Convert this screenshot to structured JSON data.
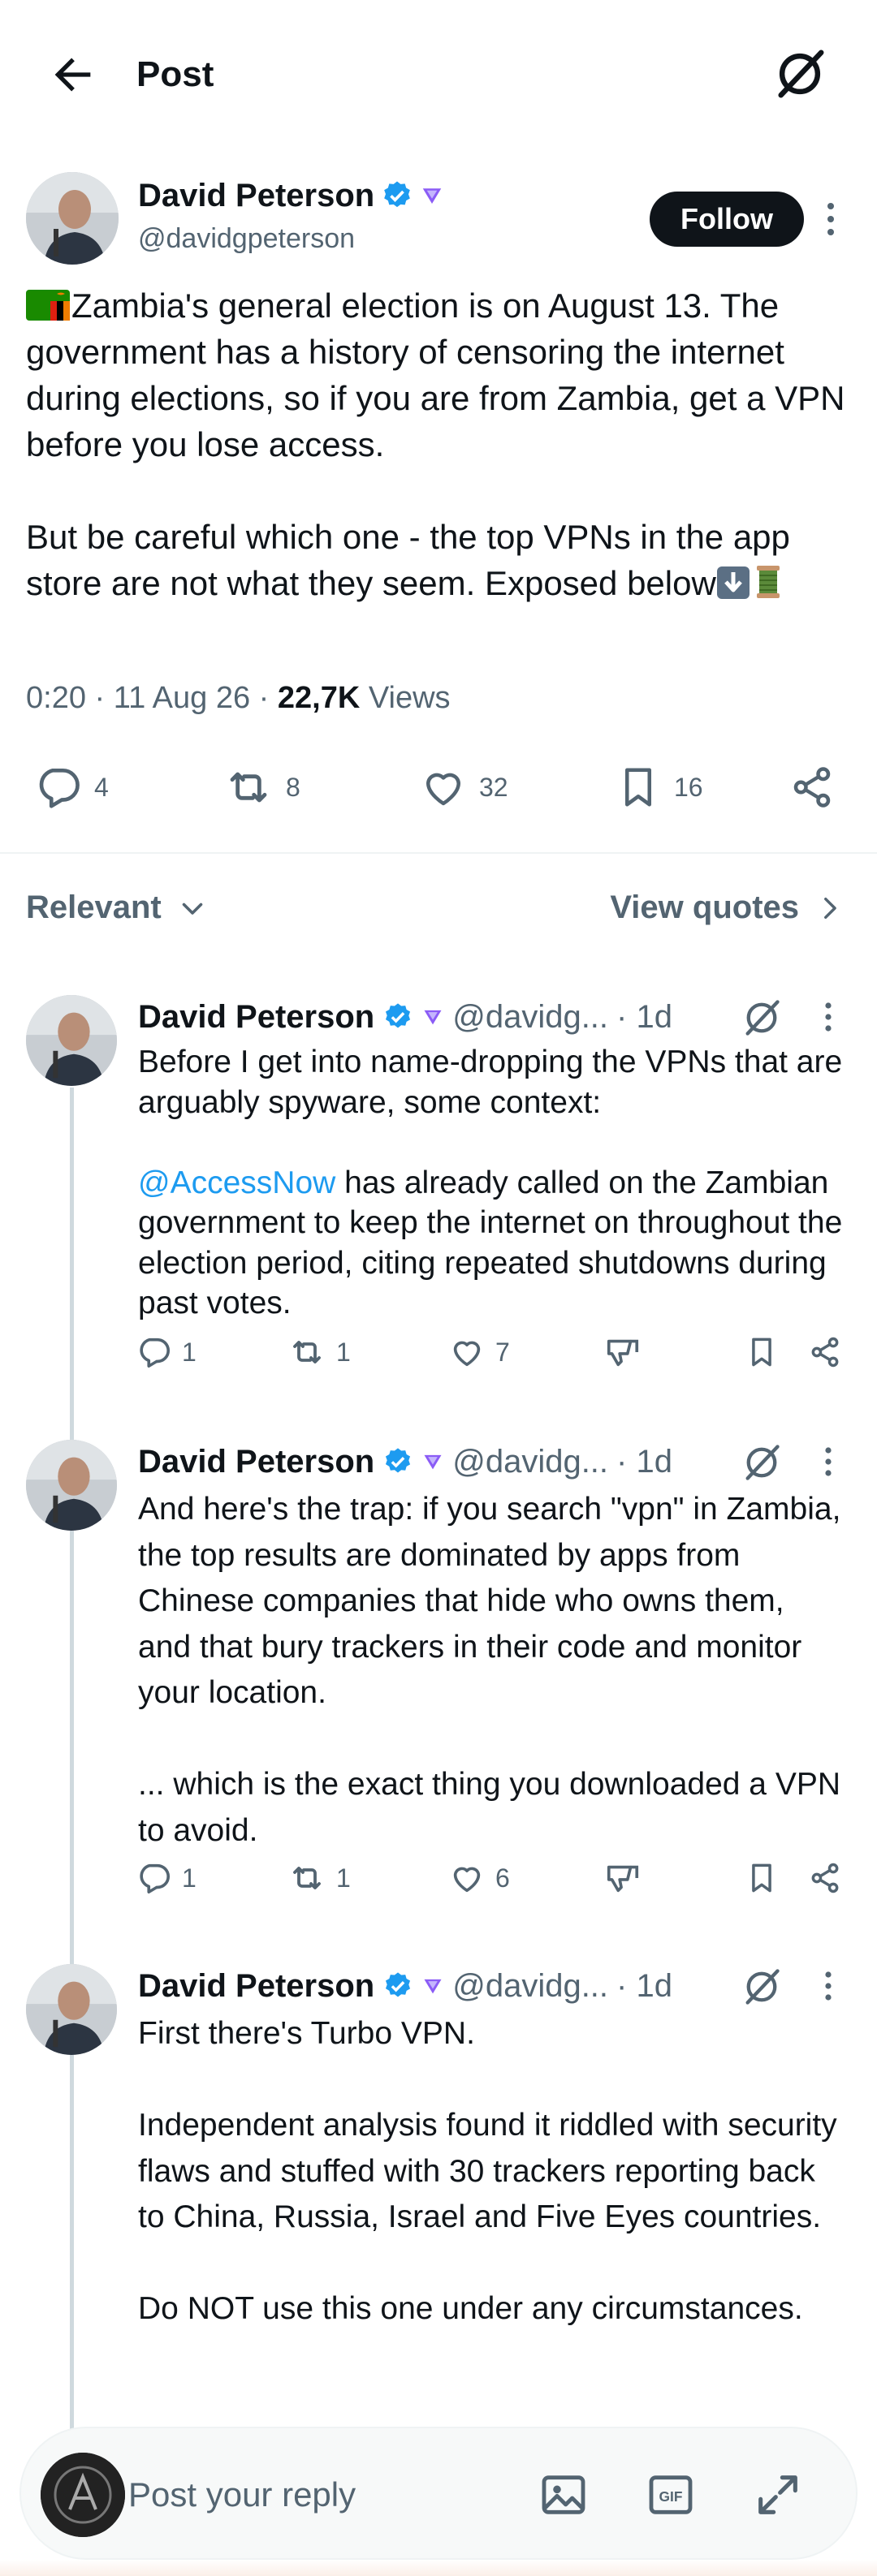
{
  "header": {
    "title": "Post"
  },
  "main_post": {
    "author_name": "David Peterson",
    "author_handle": "@davidgpeterson",
    "follow_label": "Follow",
    "paragraphs": [
      "Zambia's general election is on August 13. The government has a history of censoring the internet during elections, so if you are from Zambia, get a VPN before you lose access.",
      "But be careful which one - the top VPNs in the app store are not what they seem. Exposed below"
    ],
    "time": "0:20",
    "date": "11 Aug 26",
    "views_count": "22,7K",
    "views_label": "Views",
    "stats": {
      "replies": "4",
      "reposts": "8",
      "likes": "32",
      "bookmarks": "16"
    }
  },
  "sort": {
    "label": "Relevant",
    "view_quotes": "View quotes"
  },
  "replies": [
    {
      "author_name": "David Peterson",
      "author_handle": "@davidg...",
      "age": "· 1d",
      "text_before_mention": "Before I get into name-dropping the VPNs that are arguably spyware, some context:",
      "mention": "@AccessNow",
      "text_after_mention": " has already called on the Zambian government to keep the internet on throughout the election period, citing repeated shutdowns during past votes.",
      "replies": "1",
      "reposts": "1",
      "likes": "7"
    },
    {
      "author_name": "David Peterson",
      "author_handle": "@davidg...",
      "age": "· 1d",
      "text": "And here's the trap: if you search \"vpn\" in Zambia, the top results are dominated by apps from Chinese companies that hide who owns them, and that bury trackers in their code and monitor your location.\n\n... which is the exact thing you downloaded a VPN to avoid.",
      "replies": "1",
      "reposts": "1",
      "likes": "6"
    },
    {
      "author_name": "David Peterson",
      "author_handle": "@davidg...",
      "age": "· 1d",
      "text": "First there's Turbo VPN.\n\nIndependent analysis found it riddled with security flaws and stuffed with 30 trackers reporting back to China, Russia, Israel and Five Eyes countries.\n\nDo NOT use this one under any circumstances."
    }
  ],
  "composer": {
    "placeholder": "Post your reply"
  },
  "colors": {
    "accent": "#1d9bf0",
    "text": "#0f1419",
    "muted": "#536471",
    "verified": "#1d9bf0"
  }
}
